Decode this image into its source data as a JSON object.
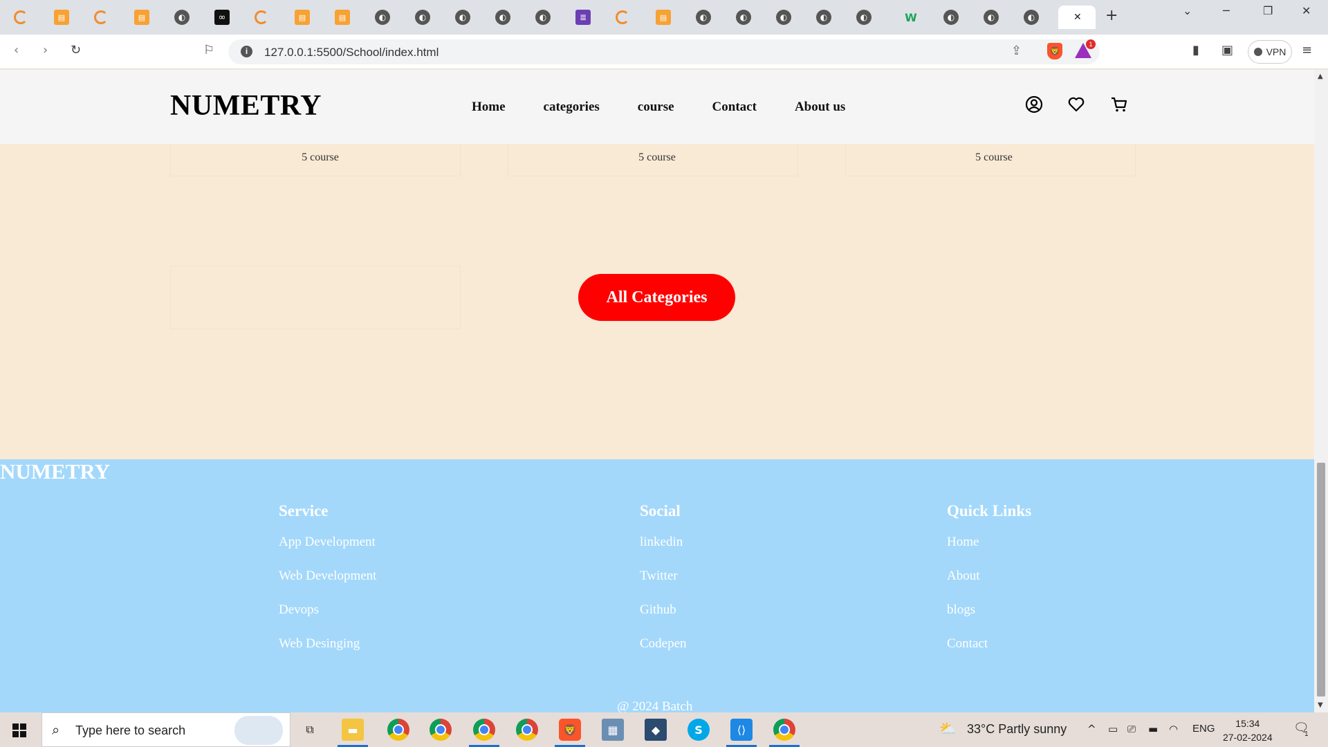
{
  "browser": {
    "url": "127.0.0.1:5500/School/index.html",
    "vpn_label": "VPN",
    "rewards_badge": "1"
  },
  "header": {
    "logo": "NUMETRY",
    "nav": [
      "Home",
      "categories",
      "course",
      "Contact",
      "About us"
    ],
    "icons": [
      "user-icon",
      "heart-icon",
      "cart-icon"
    ]
  },
  "categories": {
    "course_counts": [
      "5 course",
      "5 course",
      "5 course"
    ],
    "button_label": "All Categories",
    "button_color": "#ff0000"
  },
  "footer": {
    "brand": "NUMETRY",
    "columns": [
      {
        "title": "Service",
        "links": [
          "App Development",
          "Web Development",
          "Devops",
          "Web Desinging"
        ]
      },
      {
        "title": "Social",
        "links": [
          "linkedin",
          "Twitter",
          "Github",
          "Codepen"
        ]
      },
      {
        "title": "Quick Links",
        "links": [
          "Home",
          "About",
          "blogs",
          "Contact"
        ]
      }
    ],
    "copyright": "@ 2024 Batch",
    "background": "#a3d8fb"
  },
  "page_background": "#f9ead6",
  "taskbar": {
    "search_placeholder": "Type here to search",
    "weather": "33°C  Partly sunny",
    "language": "ENG",
    "time": "15:34",
    "date": "27-02-2024",
    "notification_count": "1"
  }
}
